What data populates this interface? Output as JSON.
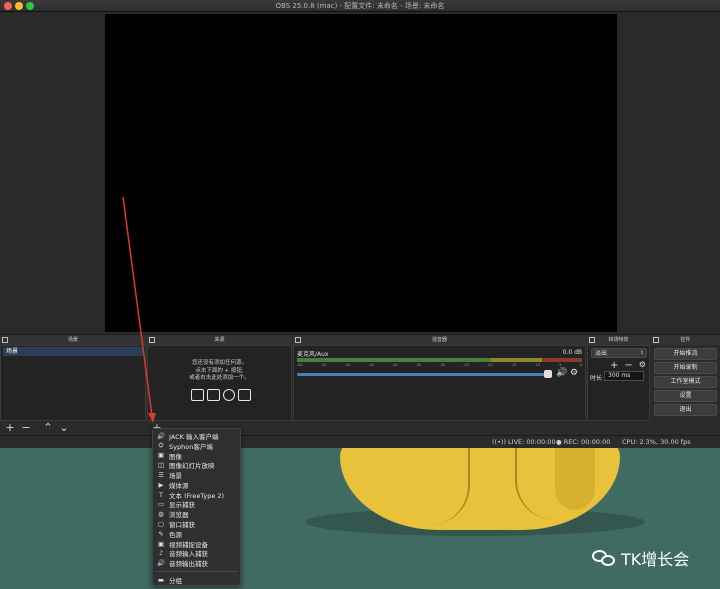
{
  "window": {
    "title": "OBS 25.0.8 (mac) - 配置文件: 未命名 - 场景: 未命名"
  },
  "docks": {
    "scenes": {
      "title": "场景",
      "items": [
        "场景"
      ],
      "add": "+",
      "remove": "−",
      "up": "⌃",
      "down": "⌄"
    },
    "sources": {
      "title": "来源",
      "empty_lines": [
        "您还没有添加任何源。",
        "点击下面的 + 按钮,",
        "或者右击此处添加一个。"
      ]
    },
    "mixer": {
      "title": "混音器",
      "track_name": "麦克风/Aux",
      "level": "0.0 dB",
      "scale": [
        "-60",
        "-55",
        "-50",
        "-45",
        "-40",
        "-35",
        "-30",
        "-25",
        "-20",
        "-15",
        "-10",
        "-5",
        "0"
      ]
    },
    "transitions": {
      "title": "转场特效",
      "selected": "淡出",
      "add": "+",
      "remove": "−",
      "duration_label": "时长",
      "duration_value": "300 ms"
    },
    "controls": {
      "title": "控件",
      "buttons": [
        "开始推流",
        "开始录制",
        "工作室模式",
        "设置",
        "退出"
      ]
    }
  },
  "status": {
    "live": "LIVE: 00:00:00",
    "rec": "REC: 00:00:00",
    "cpu": "CPU: 2.3%, 30.00 fps"
  },
  "add_source_menu": {
    "items": [
      {
        "icon": "speaker-icon",
        "glyph": "🔊",
        "label": "JACK 输入客户端"
      },
      {
        "icon": "syphon-icon",
        "glyph": "⛭",
        "label": "Syphon客户端"
      },
      {
        "icon": "image-icon",
        "glyph": "▣",
        "label": "图像"
      },
      {
        "icon": "slideshow-icon",
        "glyph": "◫",
        "label": "图像幻灯片放映"
      },
      {
        "icon": "scene-icon",
        "glyph": "☰",
        "label": "场景"
      },
      {
        "icon": "media-icon",
        "glyph": "▶",
        "label": "媒体源"
      },
      {
        "icon": "text-icon",
        "glyph": "T",
        "label": "文本 (FreeType 2)"
      },
      {
        "icon": "display-icon",
        "glyph": "▭",
        "label": "显示捕获"
      },
      {
        "icon": "globe-icon",
        "glyph": "◍",
        "label": "浏览器"
      },
      {
        "icon": "window-icon",
        "glyph": "▢",
        "label": "窗口捕获"
      },
      {
        "icon": "color-icon",
        "glyph": "✎",
        "label": "色源"
      },
      {
        "icon": "camera-icon",
        "glyph": "▣",
        "label": "视频捕捉设备"
      },
      {
        "icon": "mic-icon",
        "glyph": "♪",
        "label": "音频输入捕获"
      },
      {
        "icon": "speaker-icon",
        "glyph": "🔊",
        "label": "音频输出捕获"
      }
    ],
    "group": {
      "icon": "folder-icon",
      "glyph": "▬",
      "label": "分组"
    }
  },
  "watermark": "TK增长会",
  "colors": {
    "desktop": "#3f6b62",
    "arrow": "#d83a2c",
    "selection": "#2c3e56",
    "volume": "#4a7fc1"
  }
}
